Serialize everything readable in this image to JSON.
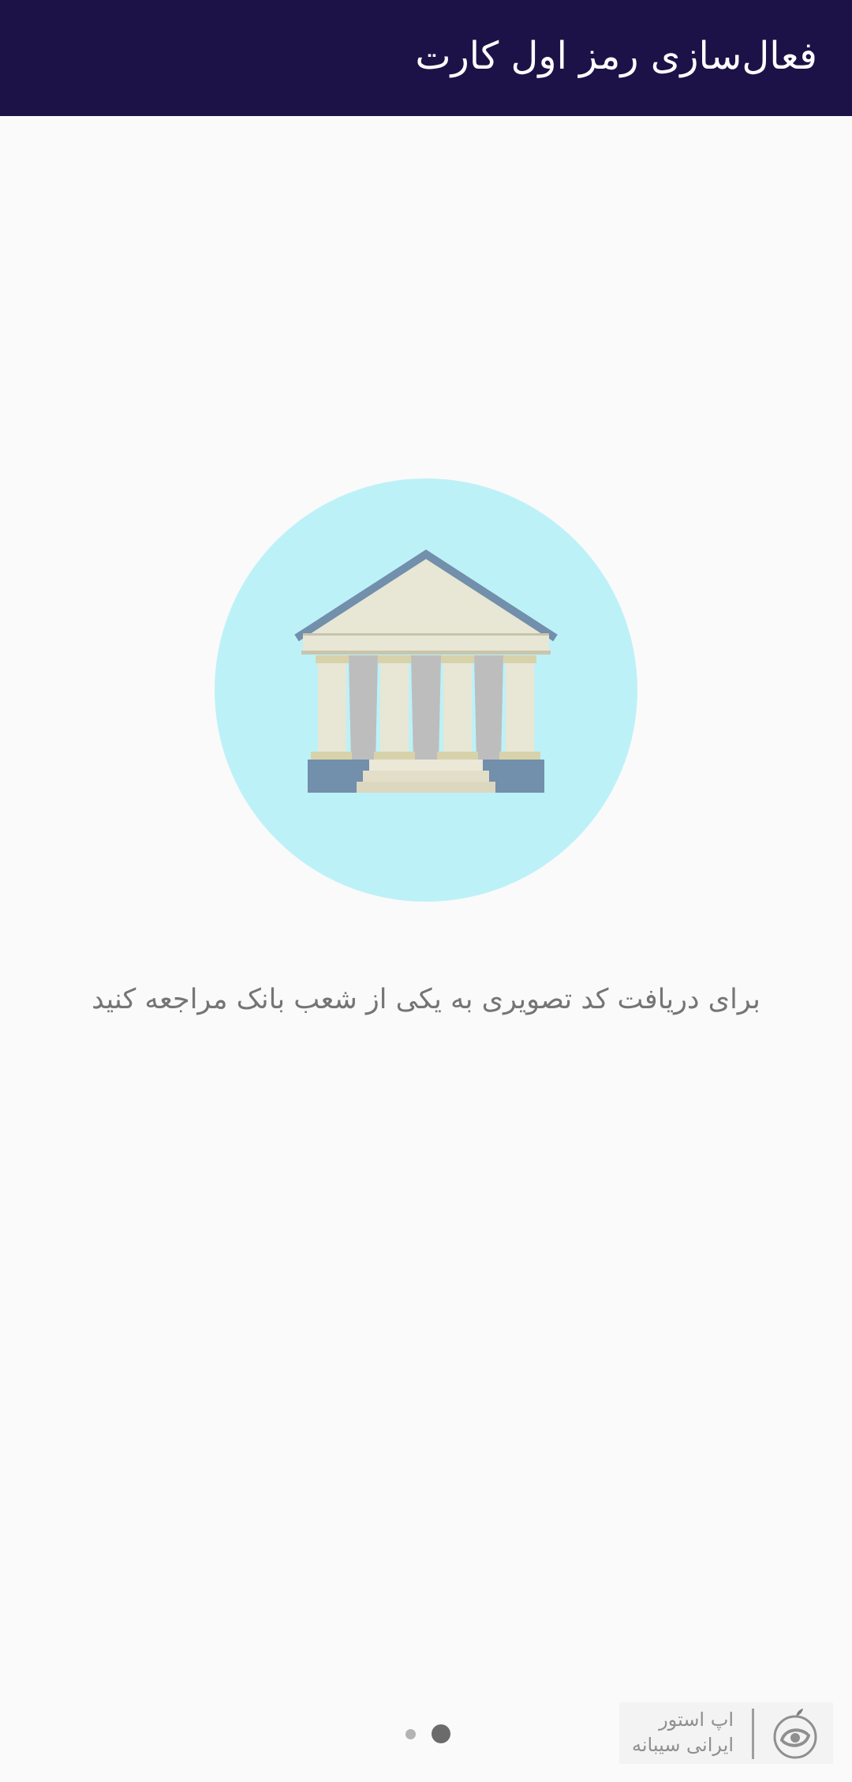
{
  "header": {
    "title": "فعال‌سازی رمز اول کارت",
    "background_color": "#1c1248"
  },
  "illustration": {
    "icon": "bank-building-icon",
    "circle_color": "#bdf1f8"
  },
  "message": {
    "text": "برای دریافت کد تصویری به یکی از شعب بانک مراجعه کنید"
  },
  "pager": {
    "page_count": 2,
    "current_page": 2
  },
  "watermark": {
    "line1": "اپ استور",
    "line2": "ایرانی سیبانه",
    "icon": "apple-logo-icon"
  }
}
